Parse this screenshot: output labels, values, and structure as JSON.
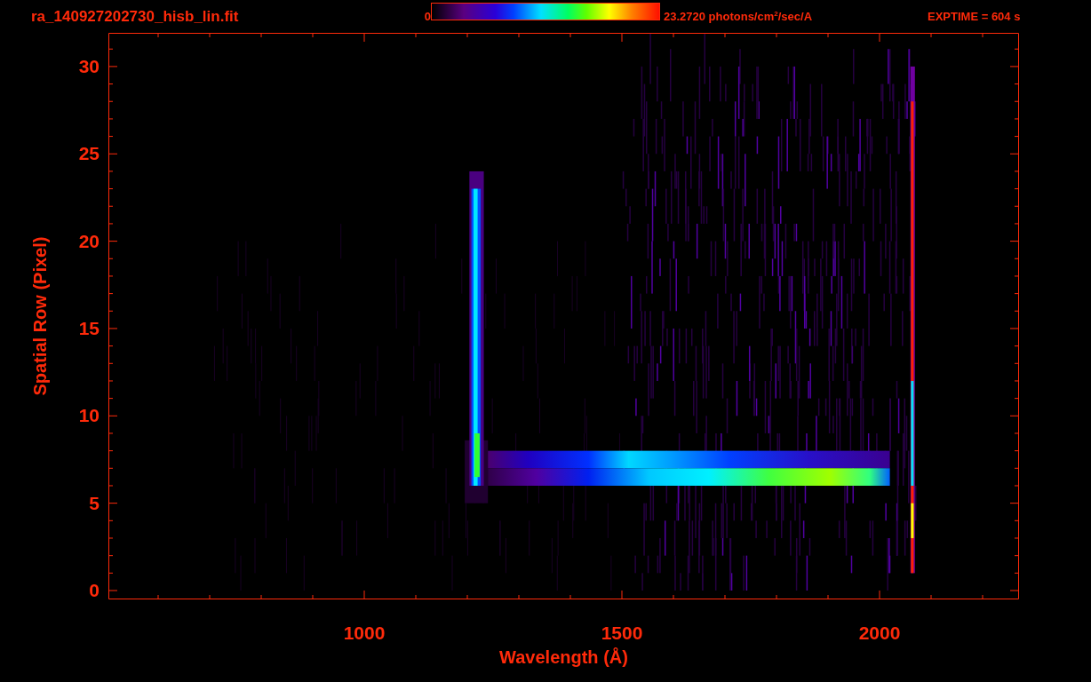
{
  "header": {
    "title": "ra_140927202730_hisb_lin.fit",
    "colorbar": {
      "min_label": "0",
      "max_label": "23.2720 photons/cm$^{2}$/sec/A"
    },
    "exposure": "EXPTIME = 604 s"
  },
  "plot": {
    "xlabel": "Wavelength (Å)",
    "ylabel": "Spatial Row (Pixel)",
    "xticks": [
      "1000",
      "1500",
      "2000"
    ],
    "yticks": [
      "30",
      "25",
      "20",
      "15",
      "10",
      "5",
      "0"
    ]
  }
}
